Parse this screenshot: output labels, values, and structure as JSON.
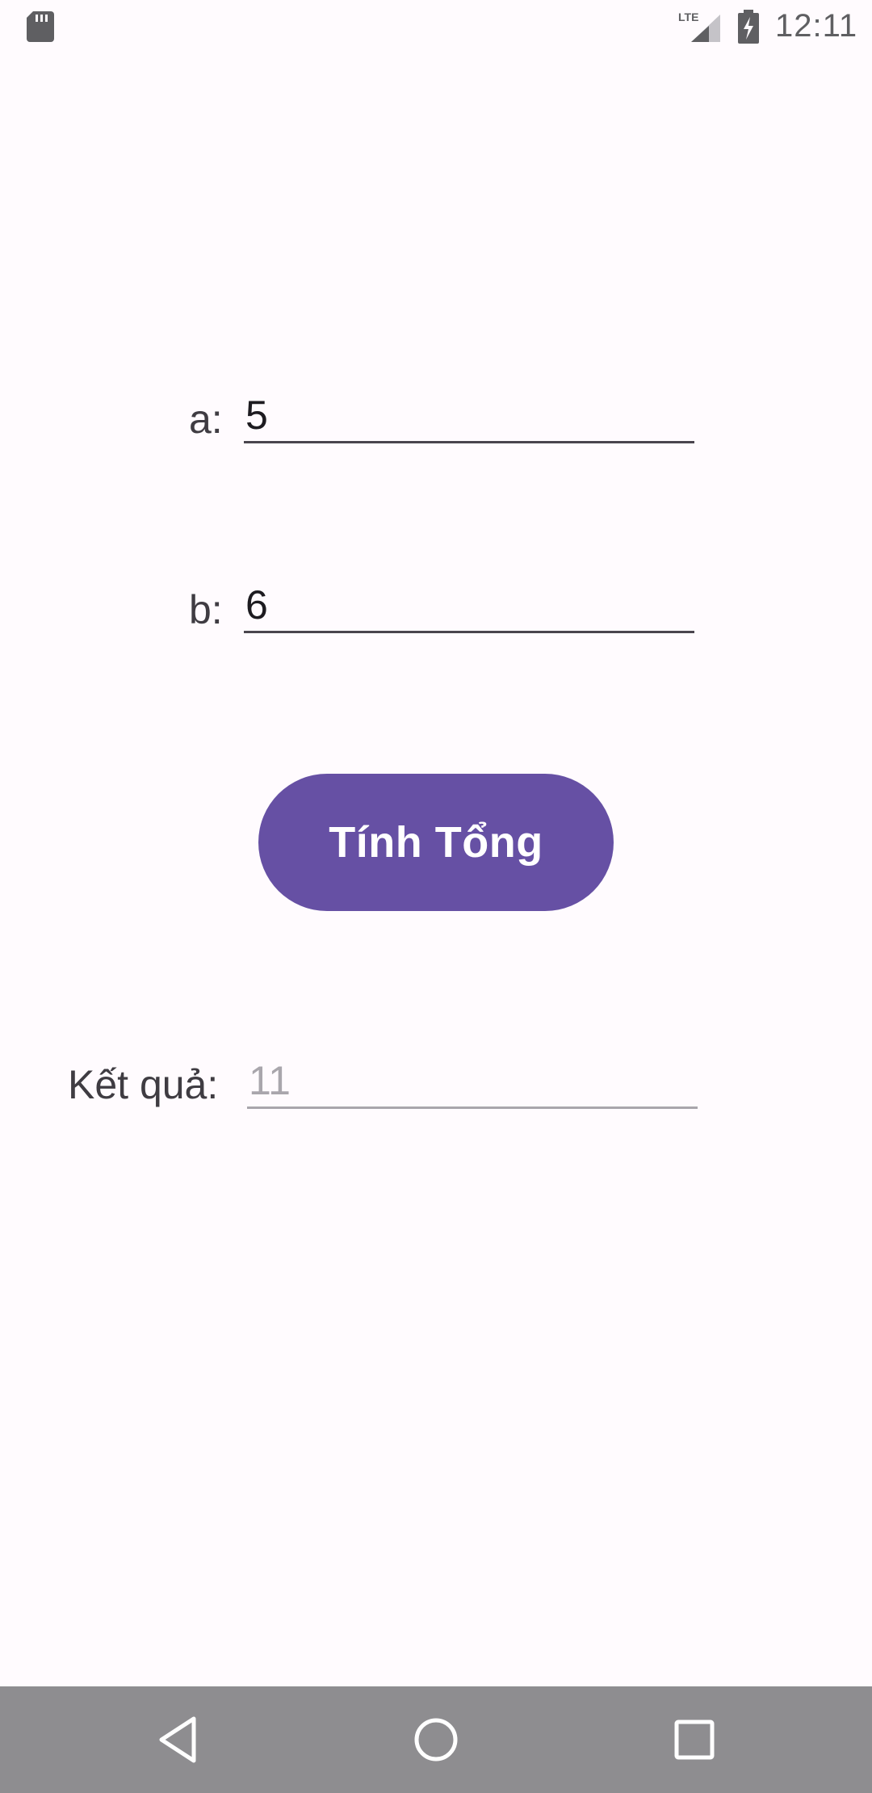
{
  "status_bar": {
    "time": "12:11",
    "network": "LTE",
    "icons": [
      "sd-card-icon",
      "lte-signal-icon",
      "battery-charging-icon"
    ]
  },
  "form": {
    "a_label": "a:",
    "a_value": "5",
    "b_label": "b:",
    "b_value": "6",
    "result_label": "Kết quả:",
    "result_value": "11"
  },
  "button": {
    "label": "Tính Tổng"
  },
  "nav_bar": {
    "icons": [
      "back-icon",
      "home-icon",
      "recents-icon"
    ]
  },
  "colors": {
    "background": "#fffbfe",
    "accent": "#6650a4",
    "nav_bar": "#8e8d90",
    "text": "#3f3c42",
    "disabled_text": "#a9a6ac"
  }
}
